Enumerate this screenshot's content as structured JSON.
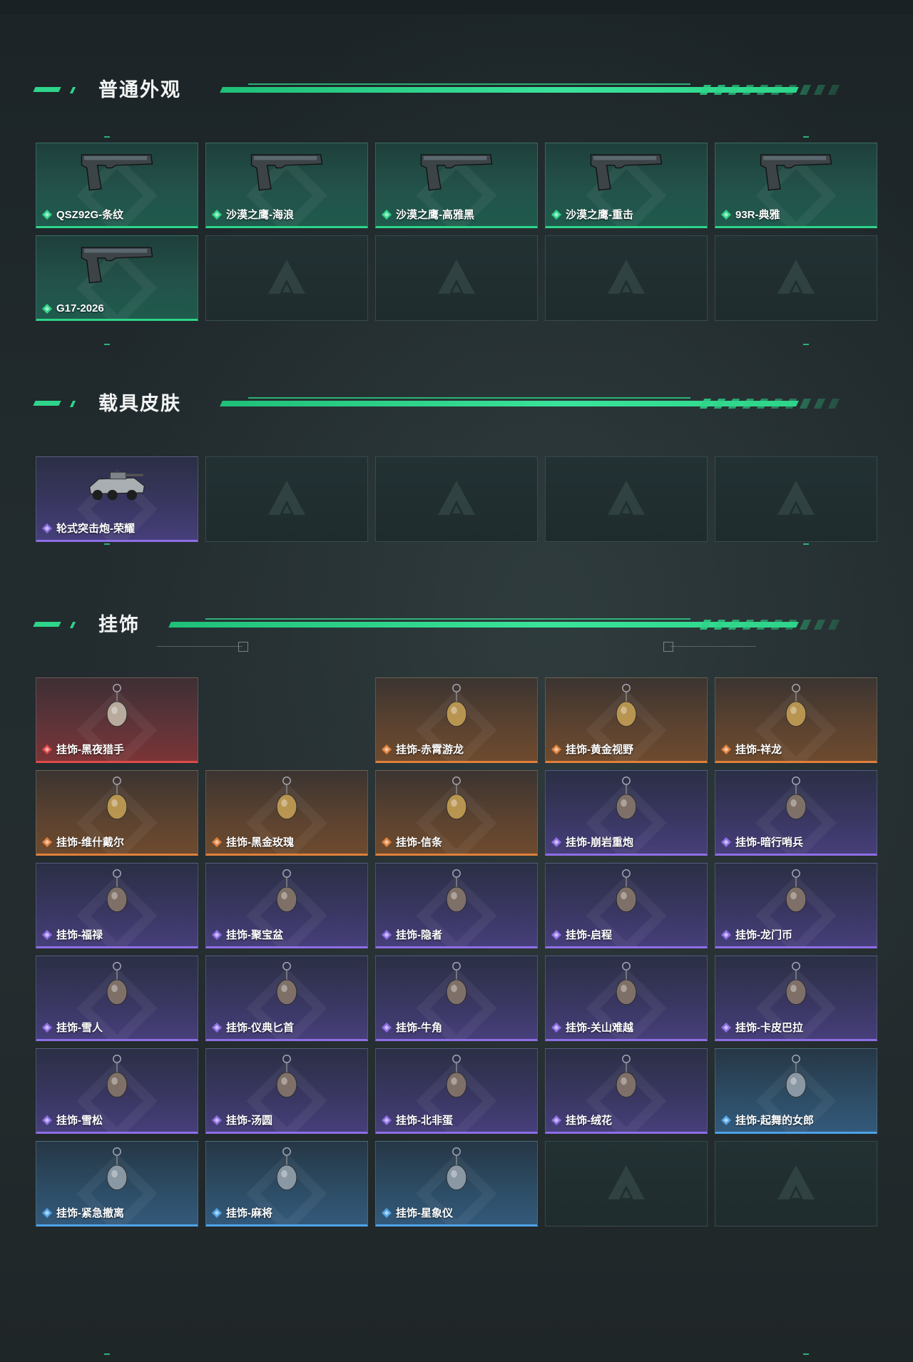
{
  "sections": [
    {
      "title": "普通外观",
      "items": [
        {
          "label": "QSZ92G-条纹",
          "rarity": "green",
          "icon": "pistol-icon"
        },
        {
          "label": "沙漠之鹰-海浪",
          "rarity": "green",
          "icon": "pistol-icon"
        },
        {
          "label": "沙漠之鹰-高雅黑",
          "rarity": "green",
          "icon": "pistol-icon"
        },
        {
          "label": "沙漠之鹰-重击",
          "rarity": "green",
          "icon": "pistol-icon"
        },
        {
          "label": "93R-典雅",
          "rarity": "green",
          "icon": "pistol-icon"
        },
        {
          "label": "G17-2026",
          "rarity": "green",
          "icon": "pistol-icon"
        }
      ]
    },
    {
      "title": "载具皮肤",
      "items": [
        {
          "label": "轮式突击炮-荣耀",
          "rarity": "purple",
          "icon": "vehicle-icon"
        }
      ]
    },
    {
      "title": "挂饰",
      "items": [
        {
          "label": "挂饰-黑夜猎手",
          "rarity": "red",
          "icon": "charm-icon"
        },
        {
          "label": "挂饰-赤霄游龙",
          "rarity": "orange",
          "icon": "charm-icon"
        },
        {
          "label": "挂饰-黄金视野",
          "rarity": "orange",
          "icon": "charm-icon"
        },
        {
          "label": "挂饰-祥龙",
          "rarity": "orange",
          "icon": "charm-icon"
        },
        {
          "label": "挂饰-维什戴尔",
          "rarity": "orange",
          "icon": "charm-icon"
        },
        {
          "label": "挂饰-黑金玫瑰",
          "rarity": "orange",
          "icon": "charm-icon"
        },
        {
          "label": "挂饰-信条",
          "rarity": "orange",
          "icon": "charm-icon"
        },
        {
          "label": "挂饰-崩岩重炮",
          "rarity": "purple",
          "icon": "charm-icon"
        },
        {
          "label": "挂饰-暗行哨兵",
          "rarity": "purple",
          "icon": "charm-icon"
        },
        {
          "label": "挂饰-福禄",
          "rarity": "purple",
          "icon": "charm-icon"
        },
        {
          "label": "挂饰-聚宝盆",
          "rarity": "purple",
          "icon": "charm-icon"
        },
        {
          "label": "挂饰-隐者",
          "rarity": "purple",
          "icon": "charm-icon"
        },
        {
          "label": "挂饰-启程",
          "rarity": "purple",
          "icon": "charm-icon"
        },
        {
          "label": "挂饰-龙门币",
          "rarity": "purple",
          "icon": "charm-icon"
        },
        {
          "label": "挂饰-雪人",
          "rarity": "purple",
          "icon": "charm-icon"
        },
        {
          "label": "挂饰-仪典匕首",
          "rarity": "purple",
          "icon": "charm-icon"
        },
        {
          "label": "挂饰-牛角",
          "rarity": "purple",
          "icon": "charm-icon"
        },
        {
          "label": "挂饰-关山难越",
          "rarity": "purple",
          "icon": "charm-icon"
        },
        {
          "label": "挂饰-卡皮巴拉",
          "rarity": "purple",
          "icon": "charm-icon"
        },
        {
          "label": "挂饰-雪松",
          "rarity": "purple",
          "icon": "charm-icon"
        },
        {
          "label": "挂饰-汤圆",
          "rarity": "purple",
          "icon": "charm-icon"
        },
        {
          "label": "挂饰-北非蛋",
          "rarity": "purple",
          "icon": "charm-icon"
        },
        {
          "label": "挂饰-绒花",
          "rarity": "purple",
          "icon": "charm-icon"
        },
        {
          "label": "挂饰-起舞的女郎",
          "rarity": "blue",
          "icon": "charm-icon"
        },
        {
          "label": "挂饰-紧急撤离",
          "rarity": "blue",
          "icon": "charm-icon"
        },
        {
          "label": "挂饰-麻将",
          "rarity": "blue",
          "icon": "charm-icon"
        },
        {
          "label": "挂饰-星象仪",
          "rarity": "blue",
          "icon": "charm-icon"
        }
      ]
    }
  ],
  "colors": {
    "accent": "#2ed489",
    "green": "#2ed489",
    "purple": "#8e6ee6",
    "orange": "#e0803c",
    "red": "#e04a4a",
    "blue": "#4ea2e6"
  }
}
